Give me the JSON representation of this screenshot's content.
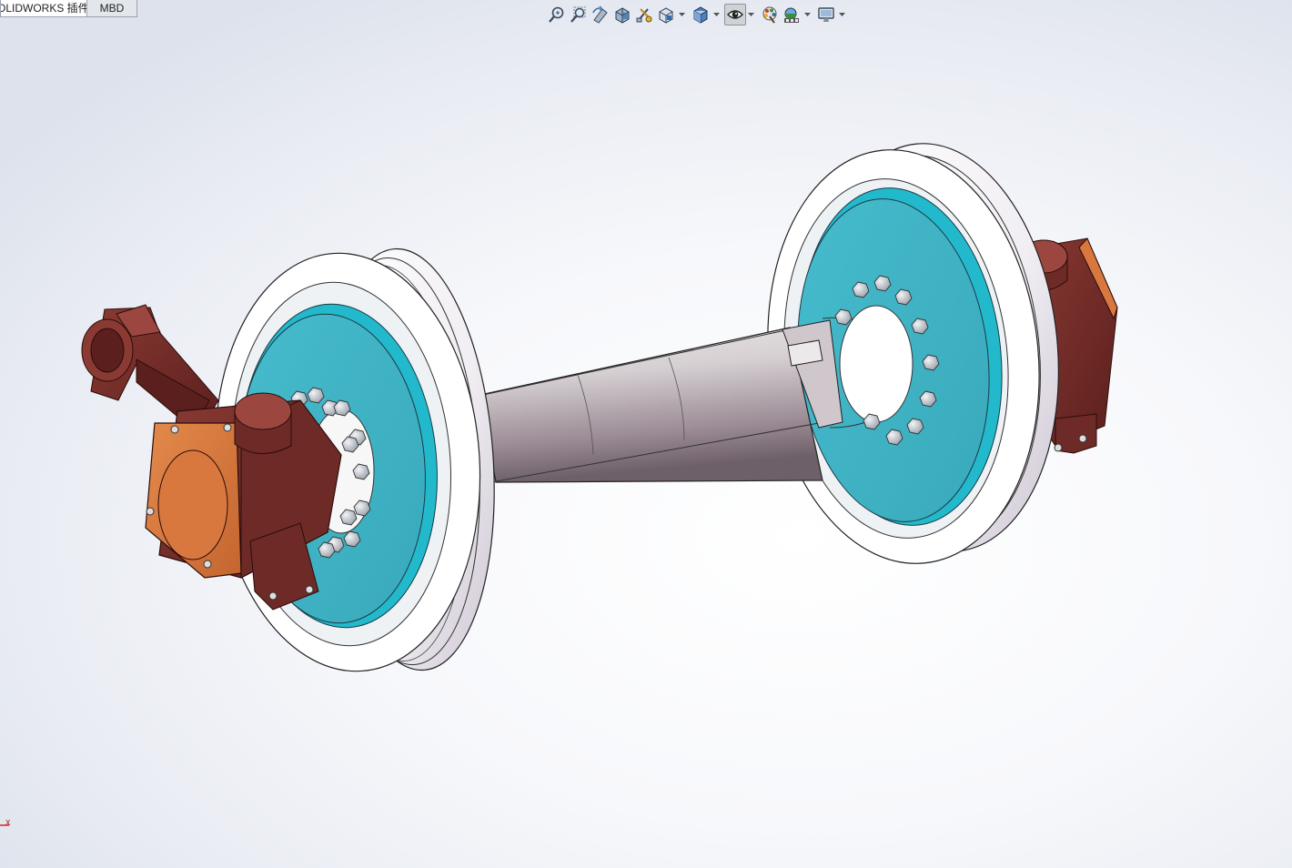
{
  "tabs": [
    {
      "label": "OLIDWORKS 插件",
      "active": false
    },
    {
      "label": "MBD",
      "active": true
    }
  ],
  "hud": {
    "buttons": [
      {
        "icon": "zoom-to-fit-icon"
      },
      {
        "icon": "zoom-to-area-icon"
      },
      {
        "icon": "previous-view-icon"
      },
      {
        "icon": "section-view-icon"
      },
      {
        "icon": "dynamic-annotation-icon"
      },
      {
        "icon": "view-orientation-icon",
        "dropdown": true
      },
      {
        "icon": "display-style-icon",
        "dropdown": true
      },
      {
        "icon": "hide-show-items-icon",
        "dropdown": true,
        "pressed": true
      },
      {
        "icon": "edit-appearance-icon"
      },
      {
        "icon": "apply-scene-icon",
        "dropdown": true
      },
      {
        "icon": "view-settings-icon",
        "dropdown": true
      }
    ]
  },
  "model": {
    "name": "wheelset-assembly",
    "colors": {
      "wheel_web": "#3fb3c6",
      "wheel_rim": "#f4f4f6",
      "axle": "#c8c0c4",
      "bearing_box": "#7a2e2a",
      "bearing_cover": "#d9783e",
      "bolts": "#c6cad2"
    }
  },
  "triad": {
    "axis_label": "X"
  }
}
